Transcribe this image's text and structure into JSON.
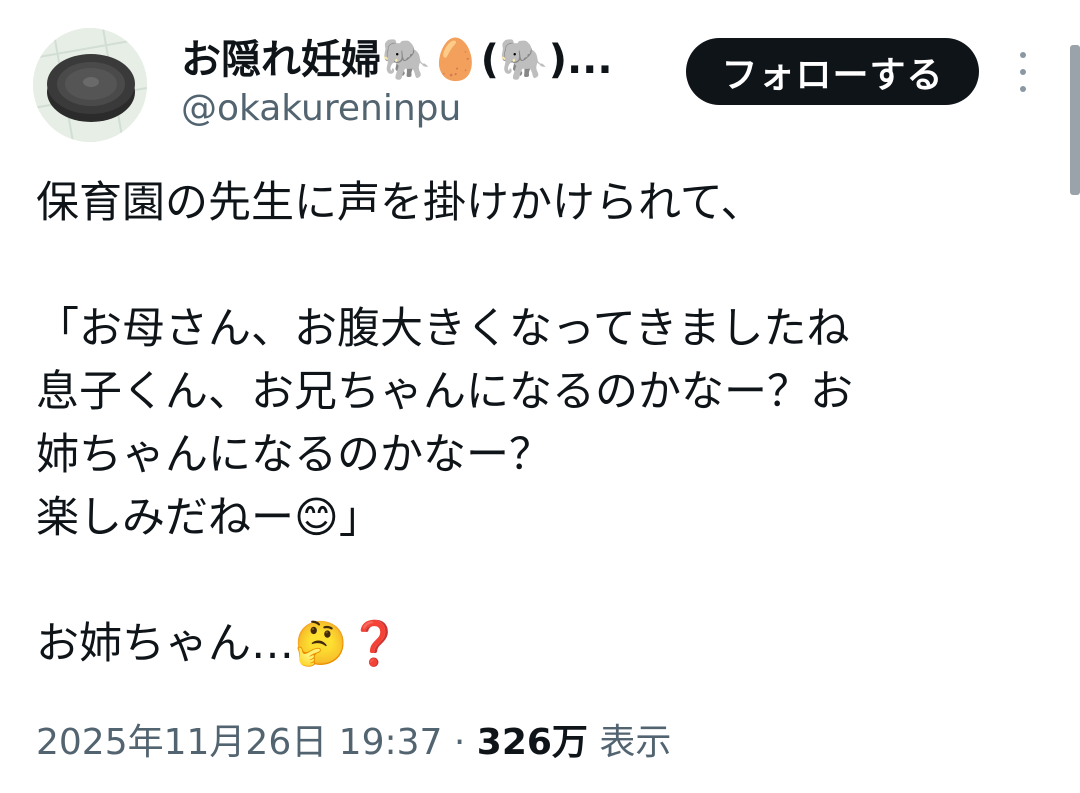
{
  "author": {
    "display_name": "お隠れ妊婦🐘🥚(🐘)...",
    "handle": "@okakureninpu",
    "avatar_icon": "robot-vacuum-avatar"
  },
  "actions": {
    "follow_label": "フォローする",
    "more_icon": "vertical-ellipsis-icon"
  },
  "tweet": {
    "lines": [
      "保育園の先生に声を掛けかけられて、",
      "",
      "「お母さん、お腹大きくなってきましたね",
      "息子くん、お兄ちゃんになるのかなー？お",
      "姉ちゃんになるのかなー？",
      "楽しみだねー😊」",
      "",
      "お姉ちゃん…🤔❓"
    ]
  },
  "meta": {
    "datetime": "2025年11月26日 19:37",
    "separator": " · ",
    "views_count": "326万",
    "views_label": " 表示"
  },
  "colors": {
    "text_primary": "#0f1419",
    "text_secondary": "#536471",
    "button_bg": "#0f1419",
    "button_text": "#ffffff"
  }
}
